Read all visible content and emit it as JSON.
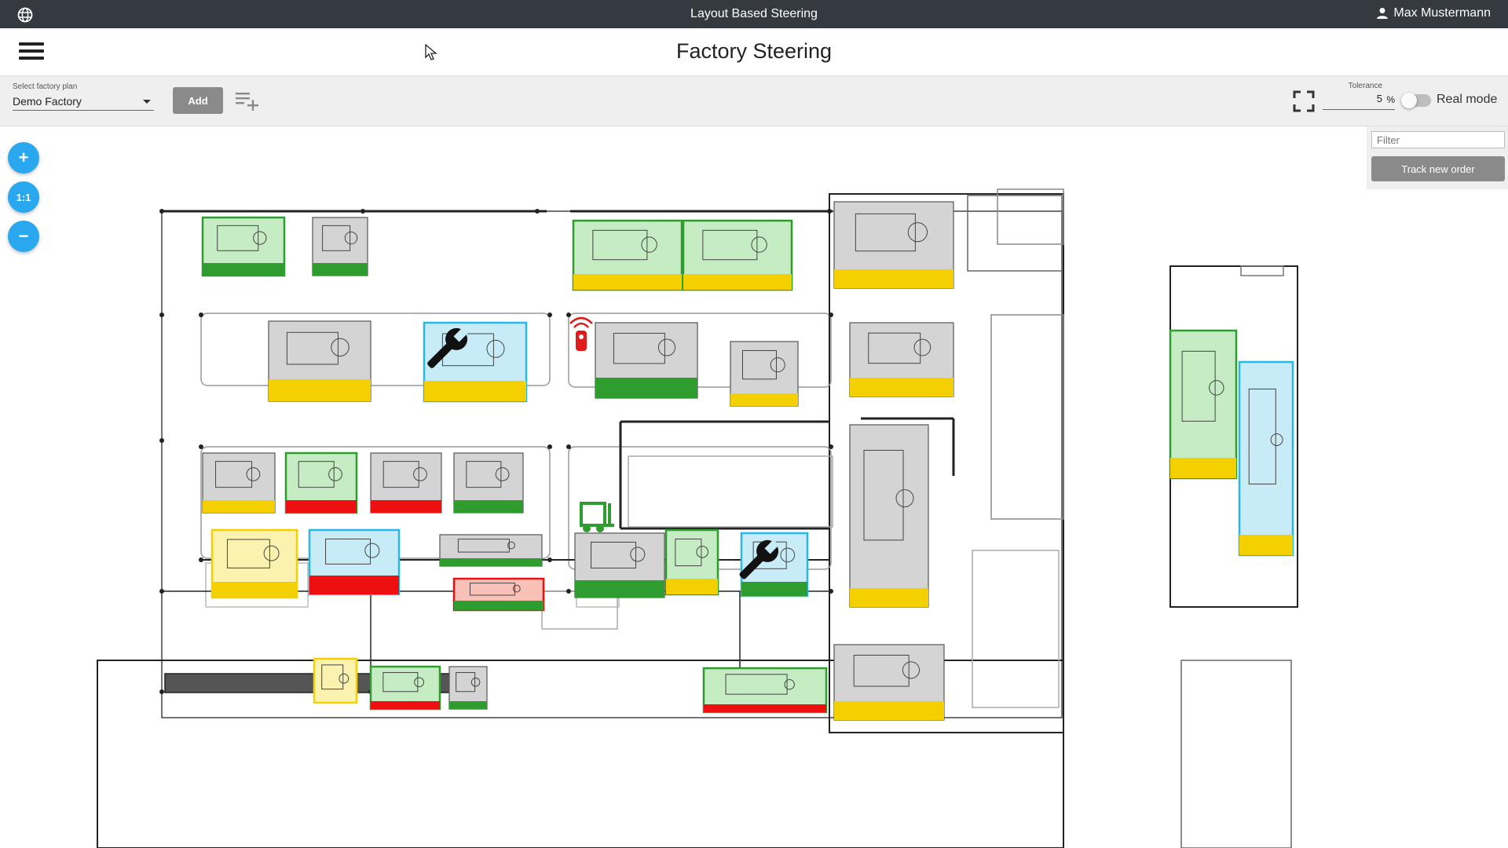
{
  "topbar": {
    "title": "Layout Based Steering",
    "user": "Max Mustermann"
  },
  "header": {
    "title": "Factory Steering"
  },
  "toolbar": {
    "select_label": "Select factory plan",
    "select_value": "Demo Factory",
    "add_label": "Add",
    "tolerance_label": "Tolerance",
    "tolerance_value": "5",
    "tolerance_unit": "%",
    "real_mode_label": "Real mode",
    "real_mode_on": false
  },
  "zoom": {
    "zoom_in": "+",
    "reset": "1:1",
    "zoom_out": "−"
  },
  "panel": {
    "filter_placeholder": "Filter",
    "track_label": "Track new order"
  },
  "colors": {
    "ok": "#2e9c2e",
    "ok_fill": "#c5ecc2",
    "busy": "#f5d000",
    "busy_fill": "#fbf2b0",
    "error": "#ee1010",
    "error_fill": "#f9c0b8",
    "maintenance": "#29b6e8",
    "maintenance_fill": "#c7ecf8",
    "idle_fill": "#d4d4d4"
  },
  "stations": [
    {
      "state": "ok",
      "status": "ok",
      "outline": "ok"
    },
    {
      "state": "idle",
      "status": "ok",
      "outline": "none"
    },
    {
      "state": "ok",
      "status": "busy",
      "outline": "ok"
    },
    {
      "state": "ok",
      "status": "busy",
      "outline": "ok"
    },
    {
      "state": "idle",
      "status": "busy",
      "outline": "none"
    },
    {
      "state": "idle",
      "status": "busy",
      "outline": "none"
    },
    {
      "state": "maintenance",
      "status": "busy",
      "outline": "maintenance"
    },
    {
      "state": "idle",
      "status": "ok",
      "outline": "none"
    },
    {
      "state": "idle",
      "status": "busy",
      "outline": "none"
    },
    {
      "state": "idle",
      "status": "busy",
      "outline": "none"
    },
    {
      "state": "idle",
      "status": "busy",
      "outline": "none"
    },
    {
      "state": "ok",
      "status": "error",
      "outline": "ok"
    },
    {
      "state": "idle",
      "status": "error",
      "outline": "none"
    },
    {
      "state": "idle",
      "status": "ok",
      "outline": "none"
    },
    {
      "state": "busy",
      "status": "busy",
      "outline": "busy"
    },
    {
      "state": "maintenance",
      "status": "error",
      "outline": "maintenance"
    },
    {
      "state": "idle",
      "status": "ok",
      "outline": "none"
    },
    {
      "state": "error",
      "status": "ok",
      "outline": "error"
    },
    {
      "state": "idle",
      "status": "ok",
      "outline": "none"
    },
    {
      "state": "ok",
      "status": "busy",
      "outline": "ok"
    },
    {
      "state": "maintenance",
      "status": "ok",
      "outline": "maintenance"
    },
    {
      "state": "idle",
      "status": "busy",
      "outline": "none"
    },
    {
      "state": "busy",
      "status": "none",
      "outline": "busy"
    },
    {
      "state": "ok",
      "status": "error",
      "outline": "ok"
    },
    {
      "state": "idle",
      "status": "ok",
      "outline": "none"
    },
    {
      "state": "ok",
      "status": "error",
      "outline": "ok"
    },
    {
      "state": "idle",
      "status": "busy",
      "outline": "none"
    },
    {
      "state": "ok",
      "status": "busy",
      "outline": "ok"
    },
    {
      "state": "maintenance",
      "status": "busy",
      "outline": "maintenance"
    }
  ]
}
